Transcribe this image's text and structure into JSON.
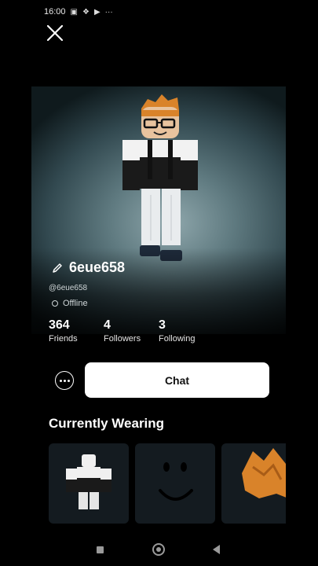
{
  "status_bar": {
    "time": "16:00",
    "icons": [
      "notification-icon",
      "dropbox-icon",
      "play-icon",
      "more-dots"
    ],
    "dots": "···"
  },
  "profile": {
    "display_name": "6eue658",
    "handle": "@6eue658",
    "presence": "Offline",
    "stats": [
      {
        "value": "364",
        "label": "Friends"
      },
      {
        "value": "4",
        "label": "Followers"
      },
      {
        "value": "3",
        "label": "Following"
      }
    ]
  },
  "actions": {
    "chat_label": "Chat"
  },
  "wearing": {
    "title": "Currently Wearing",
    "items": [
      {
        "icon": "outfit-thumbnail"
      },
      {
        "icon": "smile-face-thumbnail"
      },
      {
        "icon": "orange-hair-thumbnail"
      }
    ]
  },
  "colors": {
    "background": "#000000",
    "chat_button": "#ffffff",
    "tile": "#141b20",
    "hair": "#d9832a"
  }
}
